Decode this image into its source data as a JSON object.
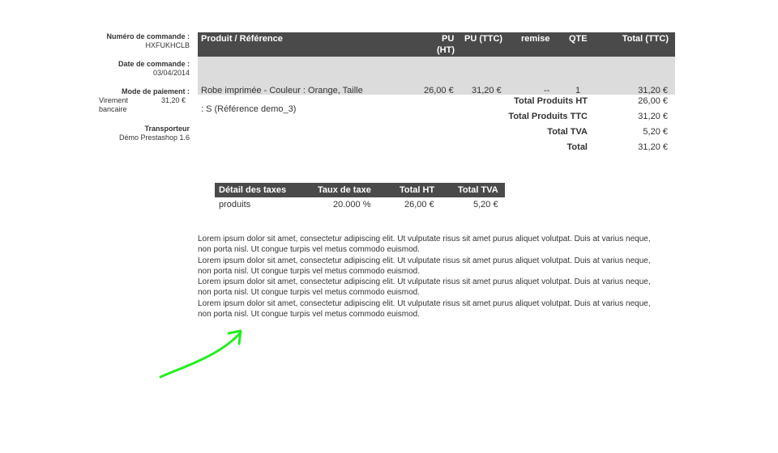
{
  "order": {
    "number_label": "Numéro de commande :",
    "number": "HXFUKHCLB",
    "date_label": "Date de commande :",
    "date": "03/04/2014",
    "payment_label": "Mode de paiement :",
    "payment_method": "Virement bancaire",
    "payment_amount": "31,20 €",
    "carrier_label": "Transporteur",
    "carrier": "Démo Prestashop 1.6"
  },
  "products_table": {
    "headers": {
      "product": "Produit / Référence",
      "pu_ht_1": "PU",
      "pu_ht_2": "(HT)",
      "pu_ttc": "PU (TTC)",
      "remise": "remise",
      "qte": "QTE",
      "total_ttc": "Total (TTC)"
    },
    "row": {
      "product_line1": "Robe imprimée - Couleur : Orange, Taille",
      "product_line2": ": S (Référence demo_3)",
      "pu_ht": "26,00 €",
      "pu_ttc": "31,20 €",
      "remise": "--",
      "qte": "1",
      "total": "31,20 €"
    }
  },
  "totals": [
    {
      "label": "Total Produits HT",
      "value": "26,00 €"
    },
    {
      "label": "Total Produits TTC",
      "value": "31,20 €"
    },
    {
      "label": "Total TVA",
      "value": "5,20 €"
    },
    {
      "label": "Total",
      "value": "31,20 €"
    }
  ],
  "tax_table": {
    "headers": {
      "detail": "Détail des taxes",
      "rate": "Taux de taxe",
      "total_ht": "Total HT",
      "total_tva": "Total TVA"
    },
    "row": {
      "detail": "produits",
      "rate": "20.000 %",
      "total_ht": "26,00 €",
      "total_tva": "5,20 €"
    }
  },
  "lorem": [
    "Lorem ipsum dolor sit amet, consectetur adipiscing elit. Ut vulputate risus sit amet purus aliquet volutpat. Duis at varius neque, non porta nisl. Ut congue turpis vel metus commodo euismod.",
    "Lorem ipsum dolor sit amet, consectetur adipiscing elit. Ut vulputate risus sit amet purus aliquet volutpat. Duis at varius neque, non porta nisl. Ut congue turpis vel metus commodo euismod.",
    "Lorem ipsum dolor sit amet, consectetur adipiscing elit. Ut vulputate risus sit amet purus aliquet volutpat. Duis at varius neque, non porta nisl. Ut congue turpis vel metus commodo euismod.",
    "Lorem ipsum dolor sit amet, consectetur adipiscing elit. Ut vulputate risus sit amet purus aliquet volutpat. Duis at varius neque, non porta nisl. Ut congue turpis vel metus commodo euismod."
  ],
  "colors": {
    "header_bg": "#4a4a4a",
    "row_bg": "#dcdcdc",
    "arrow": "#22ee22"
  }
}
